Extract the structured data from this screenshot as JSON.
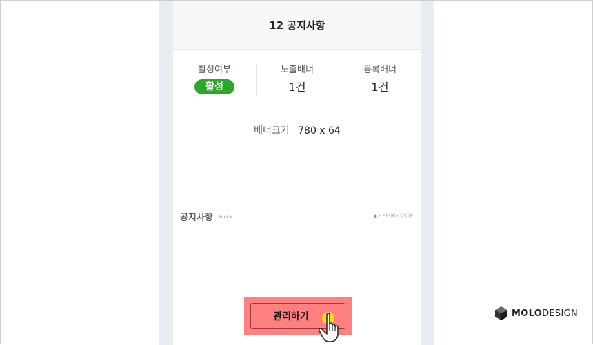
{
  "header": {
    "title": "12 공지사항"
  },
  "stats": {
    "active": {
      "label": "활성여부",
      "value": "활성"
    },
    "exposed": {
      "label": "노출배너",
      "value": "1건"
    },
    "registered": {
      "label": "등록배너",
      "value": "1건"
    }
  },
  "banner_size": {
    "label": "배너크기",
    "value": "780 x 64"
  },
  "banner_preview": {
    "title": "공지사항",
    "subtitle": "Notice",
    "breadcrumb": "> 커뮤니티 > 공지사항",
    "home_icon": "home-icon"
  },
  "actions": {
    "manage_label": "관리하기"
  },
  "logo": {
    "bold": "MOLO",
    "rest": "DESIGN",
    "icon": "cube-icon"
  },
  "colors": {
    "active_badge": "#2aa827",
    "manage_button": "#ff8080",
    "highlight": "#ffe400",
    "panel_bg": "#e8edf4"
  }
}
